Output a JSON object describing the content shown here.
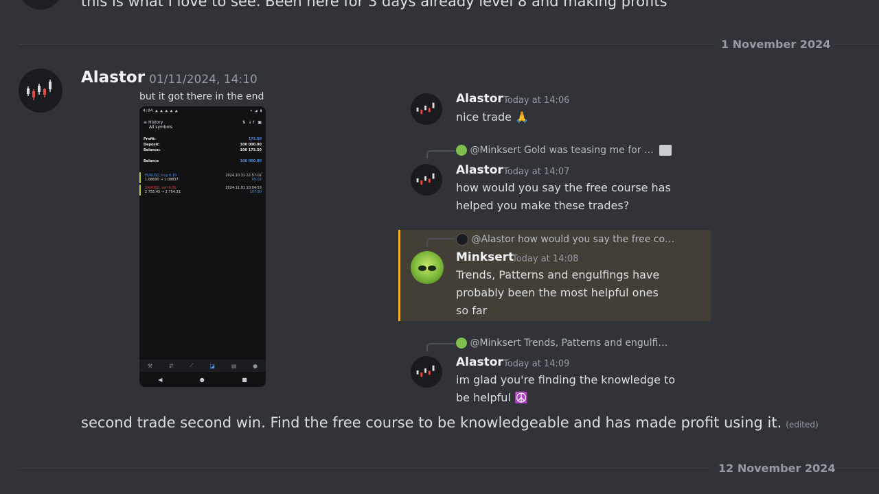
{
  "top_message": {
    "text": "this is what I love to see. Been here for 3 days already level 8 and making profits"
  },
  "dividers": [
    {
      "date": "1 November 2024"
    },
    {
      "date": "12 November 2024"
    }
  ],
  "main_message": {
    "author": "Alastor",
    "timestamp": "01/11/2024, 14:10",
    "image_caption": "but it got there in the end",
    "body": "second trade second win. Find the free course to be knowledgeable and has made profit using it.",
    "edited_label": "(edited)"
  },
  "phone_screenshot": {
    "status_time": "4:04",
    "header_title": "History",
    "header_sub": "All symbols",
    "rows": [
      {
        "label": "Profit:",
        "value": "173.50"
      },
      {
        "label": "Deposit:",
        "value": "100 000.00"
      },
      {
        "label": "Balance:",
        "value": "100 173.50"
      }
    ],
    "balance_label": "Balance",
    "trades": [
      {
        "symbol": "EURUSD, buy 0.10",
        "prices": "1.08690 → 1.08837",
        "date": "2024.10.31 22:57:02",
        "pnl": "95.02"
      },
      {
        "symbol": "XAUUSD, sell 0.01",
        "prices": "2 755.45 → 2 754.31",
        "date": "2024.11.01 10:04:53",
        "pnl": "107.90"
      }
    ]
  },
  "quoted_messages": [
    {
      "author": "Alastor",
      "time": "Today at 14:06",
      "lines": [
        "nice trade 🙏"
      ]
    },
    {
      "reply_to": "@Minksert Gold was teasing me for …",
      "author": "Alastor",
      "time": "Today at 14:07",
      "lines": [
        "how would you say the free course has",
        "helped you make these trades?"
      ]
    },
    {
      "reply_to": "@Alastor how would you say the free co…",
      "author": "Minksert",
      "time": "Today at 14:08",
      "lines": [
        "Trends, Patterns and engulfings have",
        "probably been the most helpful ones",
        "so far"
      ]
    },
    {
      "reply_to": "@Minksert Trends, Patterns and engulfi…",
      "author": "Alastor",
      "time": "Today at 14:09",
      "lines": [
        "im glad you're finding the knowledge to",
        "be helpful ☮️"
      ]
    }
  ],
  "colors": {
    "background": "#313338",
    "highlight": "#443f36",
    "highlight_bar": "#f0b232"
  }
}
